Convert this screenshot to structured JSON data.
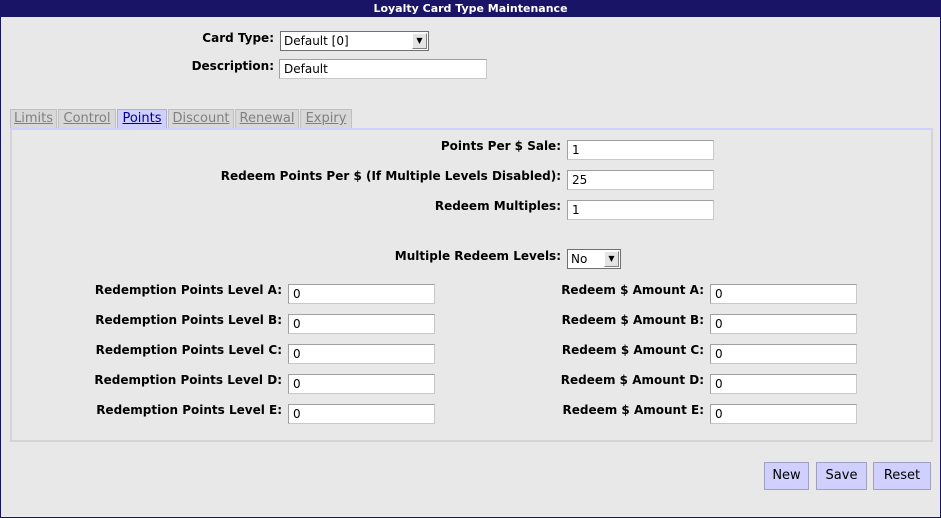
{
  "title": "Loyalty Card Type Maintenance",
  "header": {
    "card_type_label": "Card Type:",
    "card_type_value": "Default [0]",
    "description_label": "Description:",
    "description_value": "Default"
  },
  "tabs": [
    {
      "label": "Limits",
      "active": false
    },
    {
      "label": "Control",
      "active": false
    },
    {
      "label": "Points",
      "active": true
    },
    {
      "label": "Discount",
      "active": false
    },
    {
      "label": "Renewal",
      "active": false
    },
    {
      "label": "Expiry",
      "active": false
    }
  ],
  "points": {
    "points_per_sale_label": "Points Per $ Sale:",
    "points_per_sale_value": "1",
    "redeem_per_label": "Redeem Points Per $ (If Multiple Levels Disabled):",
    "redeem_per_value": "25",
    "redeem_multiples_label": "Redeem Multiples:",
    "redeem_multiples_value": "1",
    "multiple_levels_label": "Multiple Redeem Levels:",
    "multiple_levels_value": "No",
    "levels": [
      {
        "points_label": "Redemption Points Level A:",
        "points_value": "0",
        "amount_label": "Redeem $ Amount A:",
        "amount_value": "0"
      },
      {
        "points_label": "Redemption Points Level B:",
        "points_value": "0",
        "amount_label": "Redeem $ Amount B:",
        "amount_value": "0"
      },
      {
        "points_label": "Redemption Points Level C:",
        "points_value": "0",
        "amount_label": "Redeem $ Amount C:",
        "amount_value": "0"
      },
      {
        "points_label": "Redemption Points Level D:",
        "points_value": "0",
        "amount_label": "Redeem $ Amount D:",
        "amount_value": "0"
      },
      {
        "points_label": "Redemption Points Level E:",
        "points_value": "0",
        "amount_label": "Redeem $ Amount E:",
        "amount_value": "0"
      }
    ]
  },
  "buttons": {
    "new": "New",
    "save": "Save",
    "reset": "Reset"
  }
}
